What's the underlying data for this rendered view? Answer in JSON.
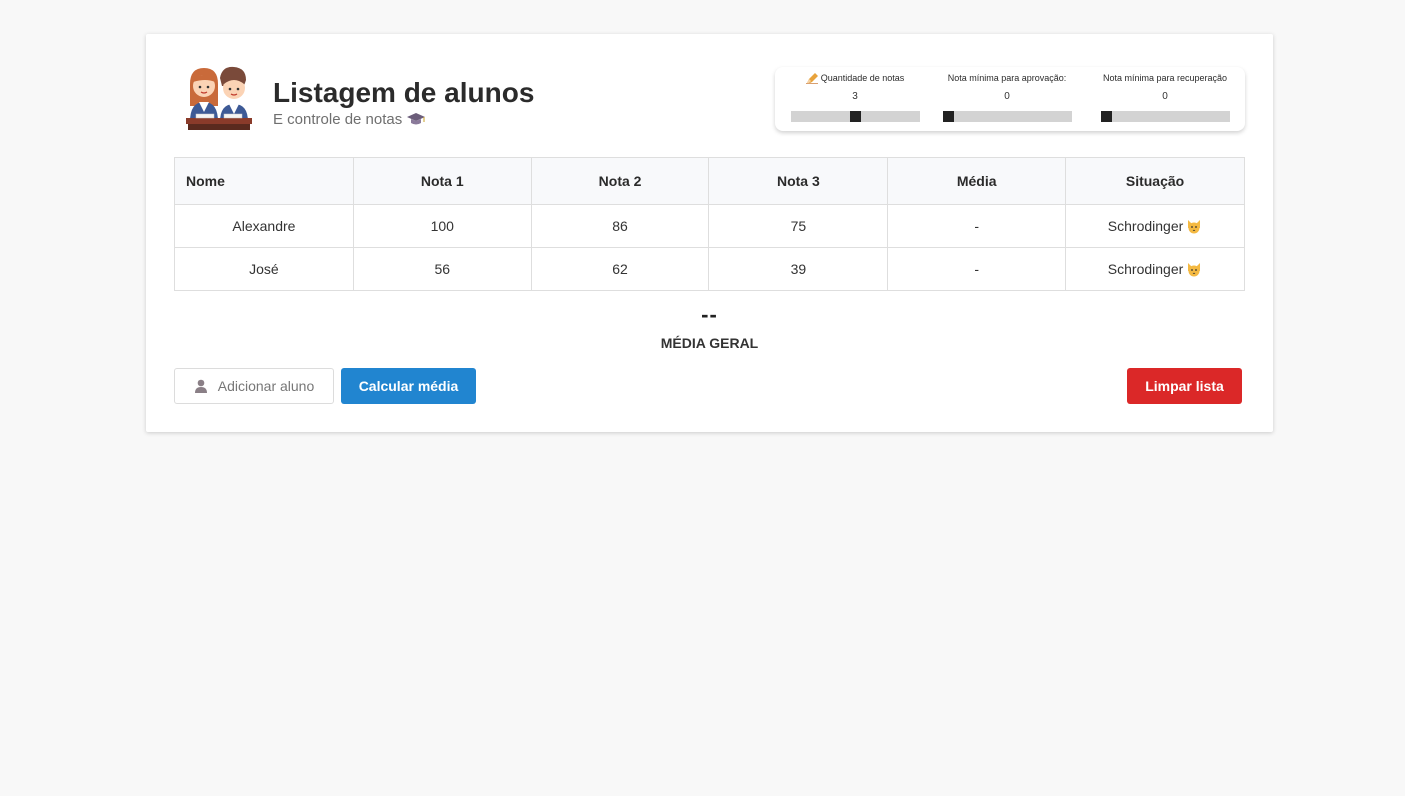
{
  "header": {
    "title": "Listagem de alunos",
    "subtitle": "E controle de notas"
  },
  "settings": [
    {
      "label": "Quantidade de notas",
      "value": "3",
      "level": 0.5,
      "icon": "pencil-icon"
    },
    {
      "label": "Nota mínima para aprovação:",
      "value": "0",
      "level": 0.0
    },
    {
      "label": "Nota mínima para recuperação",
      "value": "0",
      "level": 0.0
    }
  ],
  "table": {
    "headers": [
      "Nome",
      "Nota 1",
      "Nota 2",
      "Nota 3",
      "Média",
      "Situação"
    ],
    "rows": [
      {
        "nome": "Alexandre",
        "nota1": "100",
        "nota2": "86",
        "nota3": "75",
        "media": "-",
        "situacao": "Schrodinger"
      },
      {
        "nome": "José",
        "nota1": "56",
        "nota2": "62",
        "nota3": "39",
        "media": "-",
        "situacao": "Schrodinger"
      }
    ]
  },
  "average": {
    "value": "--",
    "label": "MÉDIA GERAL"
  },
  "buttons": {
    "add": "Adicionar aluno",
    "calc": "Calcular média",
    "clear": "Limpar lista"
  },
  "colors": {
    "primary": "#2185d0",
    "danger": "#db2828",
    "background": "#f8f8f8"
  }
}
